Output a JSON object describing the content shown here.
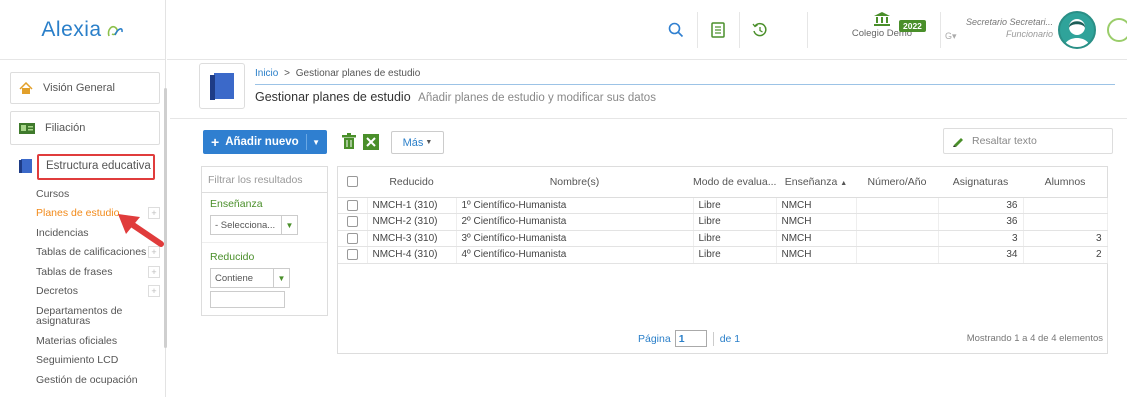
{
  "app": {
    "logo": "Alexia"
  },
  "sidebar": {
    "main": [
      {
        "label": "Visión General"
      },
      {
        "label": "Filiación"
      },
      {
        "label": "Estructura educativa"
      }
    ],
    "sub": [
      {
        "label": "Cursos",
        "plus": false
      },
      {
        "label": "Planes de estudio",
        "plus": true,
        "active": true
      },
      {
        "label": "Incidencias",
        "plus": false
      },
      {
        "label": "Tablas de calificaciones",
        "plus": true
      },
      {
        "label": "Tablas de frases",
        "plus": true
      },
      {
        "label": "Decretos",
        "plus": true
      },
      {
        "label": "Departamentos de asignaturas",
        "plus": false
      },
      {
        "label": "Materias oficiales",
        "plus": false
      },
      {
        "label": "Seguimiento LCD",
        "plus": false
      },
      {
        "label": "Gestión de ocupación",
        "plus": false
      }
    ]
  },
  "header": {
    "school": "Colegio Demo",
    "year": "2022",
    "user_name": "Secretario Secretari...",
    "user_role": "Funcionario",
    "user_g": "G▾"
  },
  "breadcrumb": {
    "home": "Inicio",
    "separator": ">",
    "current": "Gestionar planes de estudio",
    "title": "Gestionar planes de estudio",
    "description": "Añadir planes de estudio y modificar sus datos"
  },
  "toolbar": {
    "add_label": "Añadir nuevo",
    "more_label": "Más",
    "highlight_placeholder": "Resaltar texto"
  },
  "filter": {
    "header": "Filtrar los resultados",
    "ensenanza_label": "Enseñanza",
    "ensenanza_value": "- Selecciona...",
    "reducido_label": "Reducido",
    "reducido_value": "Contiene"
  },
  "table": {
    "columns": [
      "Reducido",
      "Nombre(s)",
      "Modo de evalua...",
      "Enseñanza",
      "Número/Año",
      "Asignaturas",
      "Alumnos"
    ],
    "rows": [
      {
        "reducido": "NMCH-1 (310)",
        "nombre": "1º Científico-Humanista",
        "modo": "Libre",
        "ensenanza": "NMCH",
        "numero": "",
        "asignaturas": "36",
        "alumnos": ""
      },
      {
        "reducido": "NMCH-2 (310)",
        "nombre": "2º Científico-Humanista",
        "modo": "Libre",
        "ensenanza": "NMCH",
        "numero": "",
        "asignaturas": "36",
        "alumnos": ""
      },
      {
        "reducido": "NMCH-3 (310)",
        "nombre": "3º Científico-Humanista",
        "modo": "Libre",
        "ensenanza": "NMCH",
        "numero": "",
        "asignaturas": "3",
        "alumnos": "3"
      },
      {
        "reducido": "NMCH-4 (310)",
        "nombre": "4º Científico-Humanista",
        "modo": "Libre",
        "ensenanza": "NMCH",
        "numero": "",
        "asignaturas": "34",
        "alumnos": "2"
      }
    ],
    "pager_label": "Página",
    "page": "1",
    "of_label": "de 1",
    "showing": "Mostrando 1 a 4 de 4 elementos"
  },
  "colors": {
    "accent": "#2f7fd0",
    "green": "#4a8f2a",
    "active_item": "#f28a1a",
    "annotation": "#e03c3c"
  }
}
